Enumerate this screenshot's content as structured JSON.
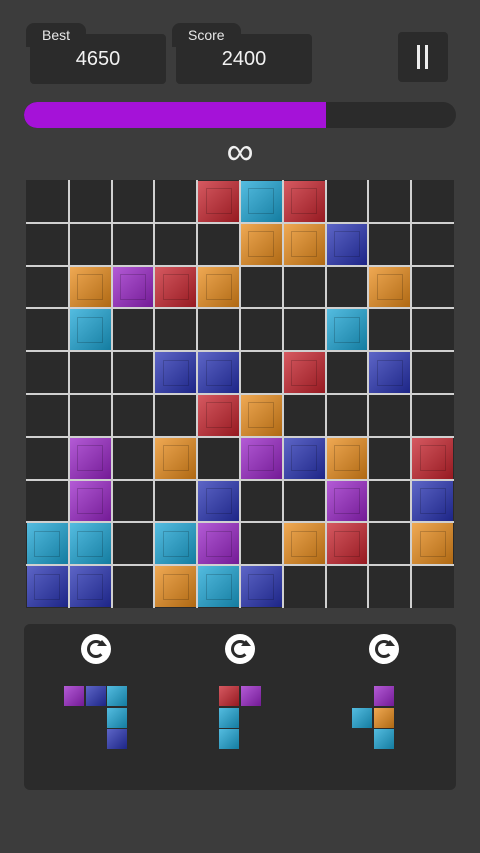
{
  "stats": {
    "best_label": "Best",
    "best_value": "4650",
    "score_label": "Score",
    "score_value": "2400"
  },
  "progress": {
    "fraction": 0.7,
    "color": "#a512d8"
  },
  "mode_symbol": "∞",
  "colors": {
    "R": "#c8222c",
    "C": "#1ba6d6",
    "O": "#ea8c1a",
    "B": "#2732b4",
    "P": "#9a24c8"
  },
  "board": {
    "rows": [
      "....RCR...",
      ".....OOB..",
      ".OPRO...O.",
      ".C.....C..",
      "...BB.R.B.",
      "....RO....",
      ".P.O.PBO.R",
      ".P..B..P.B",
      "CC.CP.OR.O",
      "BB.OCB...."
    ]
  },
  "tray": {
    "rotate_icon": "rotate-icon",
    "pieces": [
      {
        "cells": [
          [
            0,
            0,
            "P"
          ],
          [
            1,
            0,
            "B"
          ],
          [
            2,
            0,
            "C"
          ],
          [
            2,
            1,
            "C"
          ],
          [
            2,
            2,
            "B"
          ]
        ]
      },
      {
        "cells": [
          [
            0,
            0,
            "R"
          ],
          [
            1,
            0,
            "P"
          ],
          [
            0,
            1,
            "C"
          ],
          [
            0,
            2,
            "C"
          ]
        ]
      },
      {
        "cells": [
          [
            1,
            0,
            "P"
          ],
          [
            0,
            1,
            "C"
          ],
          [
            1,
            1,
            "O"
          ],
          [
            1,
            2,
            "C"
          ]
        ]
      }
    ]
  }
}
